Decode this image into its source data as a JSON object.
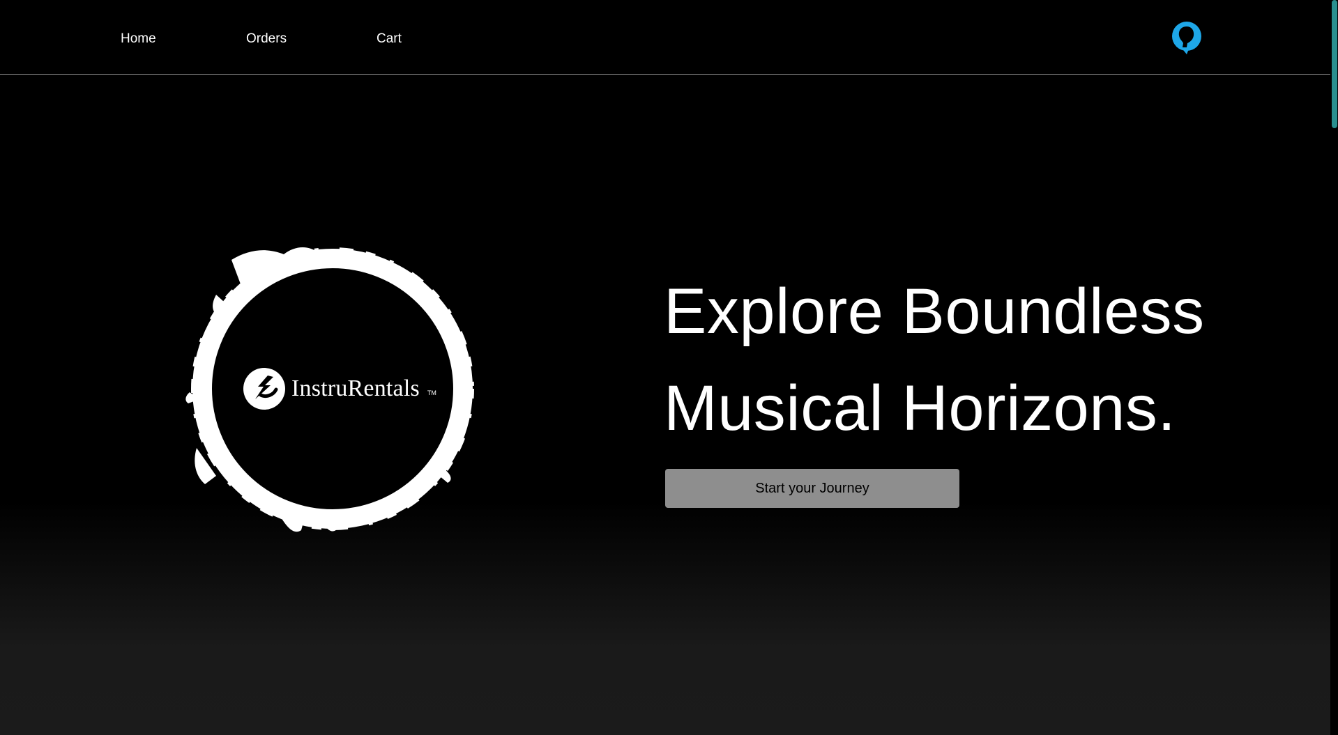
{
  "nav": {
    "home": "Home",
    "orders": "Orders",
    "cart": "Cart"
  },
  "profile": {
    "icon": "user-profile-icon",
    "color": "#1ea7e8"
  },
  "hero": {
    "logo_text": "InstruRentals",
    "logo_tm": "TM",
    "headline_line1": "Explore Boundless",
    "headline_line2": "Musical Horizons.",
    "cta_label": "Start your Journey"
  },
  "colors": {
    "background": "#000000",
    "cta_background": "#8e8e8e",
    "scroll_thumb": "#2a8f8f"
  }
}
